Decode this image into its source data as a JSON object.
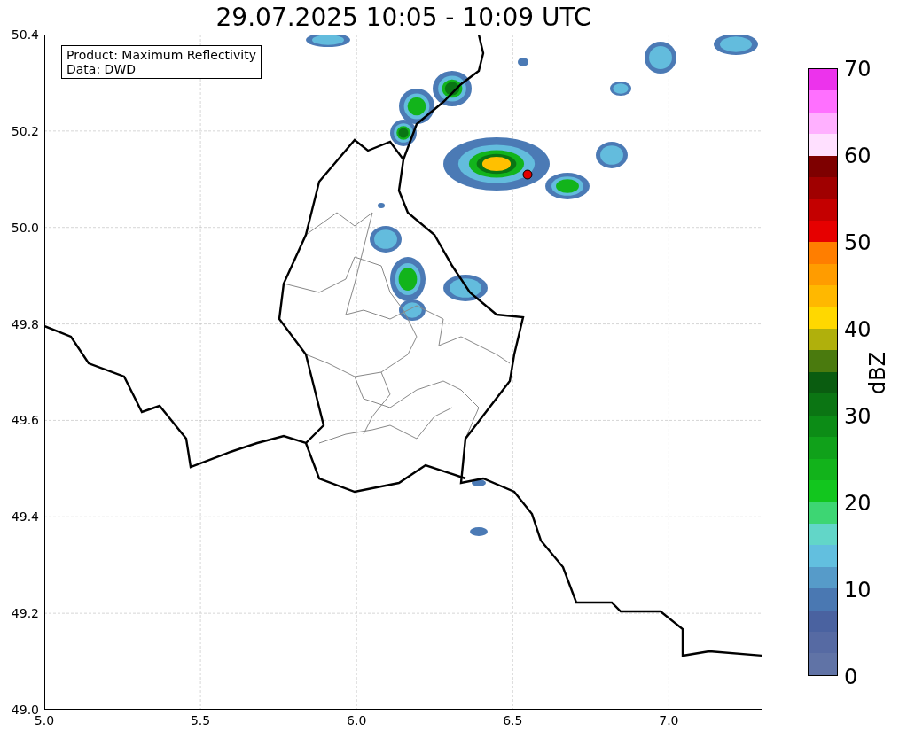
{
  "title": "29.07.2025 10:05 - 10:09 UTC",
  "info_box": {
    "lines": [
      "Product: Maximum Reflectivity",
      "Data: DWD"
    ]
  },
  "map": {
    "yticks": [
      "50.4",
      "50.2",
      "50.0",
      "49.8",
      "49.6",
      "49.4",
      "49.2",
      "49.0"
    ],
    "xticks": [
      "5.0",
      "5.5",
      "6.0",
      "6.5",
      "7.0"
    ]
  },
  "colorbar": {
    "label": "dBZ",
    "ticks": [
      "70",
      "60",
      "50",
      "40",
      "30",
      "20",
      "10",
      "0"
    ],
    "segments": [
      {
        "color": "#ec33ec"
      },
      {
        "color": "#ff70ff"
      },
      {
        "color": "#ffb0ff"
      },
      {
        "color": "#ffe0ff"
      },
      {
        "color": "#7e0000"
      },
      {
        "color": "#a00000"
      },
      {
        "color": "#c40000"
      },
      {
        "color": "#e60000"
      },
      {
        "color": "#ff7e00"
      },
      {
        "color": "#ff9c00"
      },
      {
        "color": "#ffb800"
      },
      {
        "color": "#ffd800"
      },
      {
        "color": "#b0b00c"
      },
      {
        "color": "#4a7a0e"
      },
      {
        "color": "#0a5c10"
      },
      {
        "color": "#0b7513"
      },
      {
        "color": "#0c8c16"
      },
      {
        "color": "#10a11a"
      },
      {
        "color": "#12b31b"
      },
      {
        "color": "#12c61e"
      },
      {
        "color": "#3dd673"
      },
      {
        "color": "#62d6c8"
      },
      {
        "color": "#62bfdf"
      },
      {
        "color": "#569bc9"
      },
      {
        "color": "#4a78b2"
      },
      {
        "color": "#4a62a0"
      },
      {
        "color": "#566aa3"
      },
      {
        "color": "#6073a6"
      }
    ]
  }
}
